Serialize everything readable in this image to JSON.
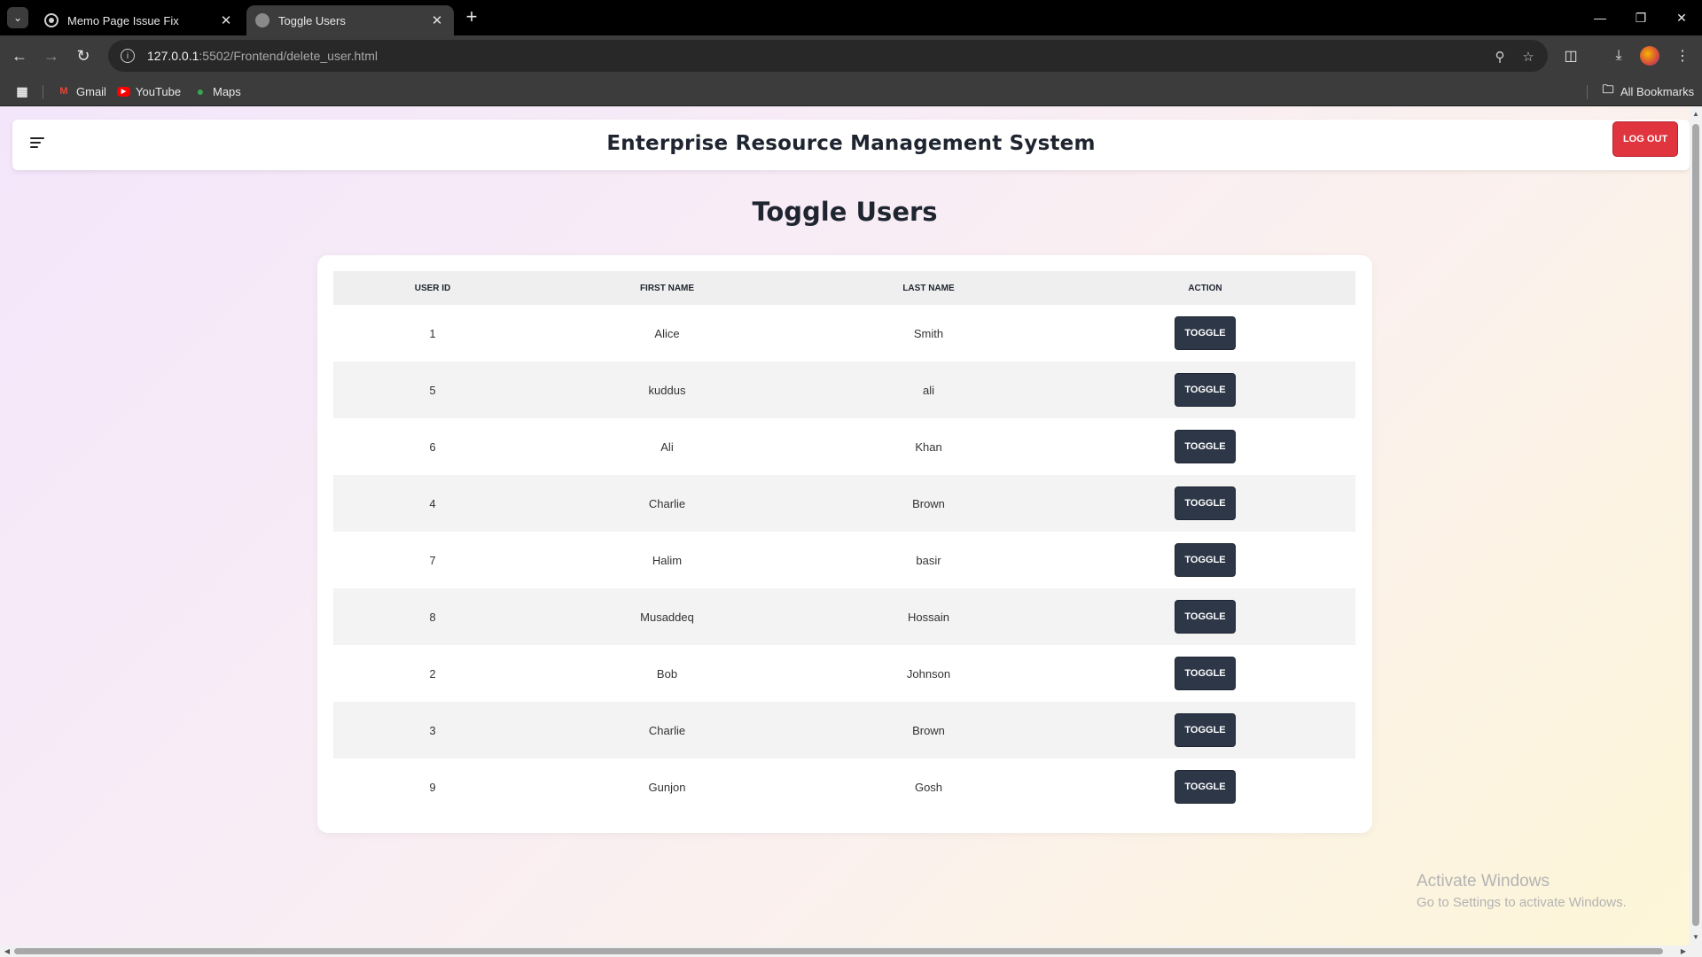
{
  "browser": {
    "tabs": [
      {
        "title": "Memo Page Issue Fix",
        "active": false
      },
      {
        "title": "Toggle Users",
        "active": true
      }
    ],
    "url_host": "127.0.0.1",
    "url_rest": ":5502/Frontend/delete_user.html",
    "bookmarks": [
      "Gmail",
      "YouTube",
      "Maps"
    ],
    "all_bookmarks": "All Bookmarks"
  },
  "header": {
    "title": "Enterprise Resource Management System",
    "logout_label": "LOG OUT"
  },
  "page": {
    "heading": "Toggle Users"
  },
  "table": {
    "columns": [
      "USER ID",
      "FIRST NAME",
      "LAST NAME",
      "ACTION"
    ],
    "action_label": "TOGGLE",
    "rows": [
      {
        "id": "1",
        "first": "Alice",
        "last": "Smith"
      },
      {
        "id": "5",
        "first": "kuddus",
        "last": "ali"
      },
      {
        "id": "6",
        "first": "Ali",
        "last": "Khan"
      },
      {
        "id": "4",
        "first": "Charlie",
        "last": "Brown"
      },
      {
        "id": "7",
        "first": "Halim",
        "last": "basir"
      },
      {
        "id": "8",
        "first": "Musaddeq",
        "last": "Hossain"
      },
      {
        "id": "2",
        "first": "Bob",
        "last": "Johnson"
      },
      {
        "id": "3",
        "first": "Charlie",
        "last": "Brown"
      },
      {
        "id": "9",
        "first": "Gunjon",
        "last": "Gosh"
      }
    ]
  },
  "watermark": {
    "line1": "Activate Windows",
    "line2": "Go to Settings to activate Windows."
  },
  "colors": {
    "logout_bg": "#e0353e",
    "toggle_bg": "#2d3748",
    "title_text": "#1f2530"
  }
}
